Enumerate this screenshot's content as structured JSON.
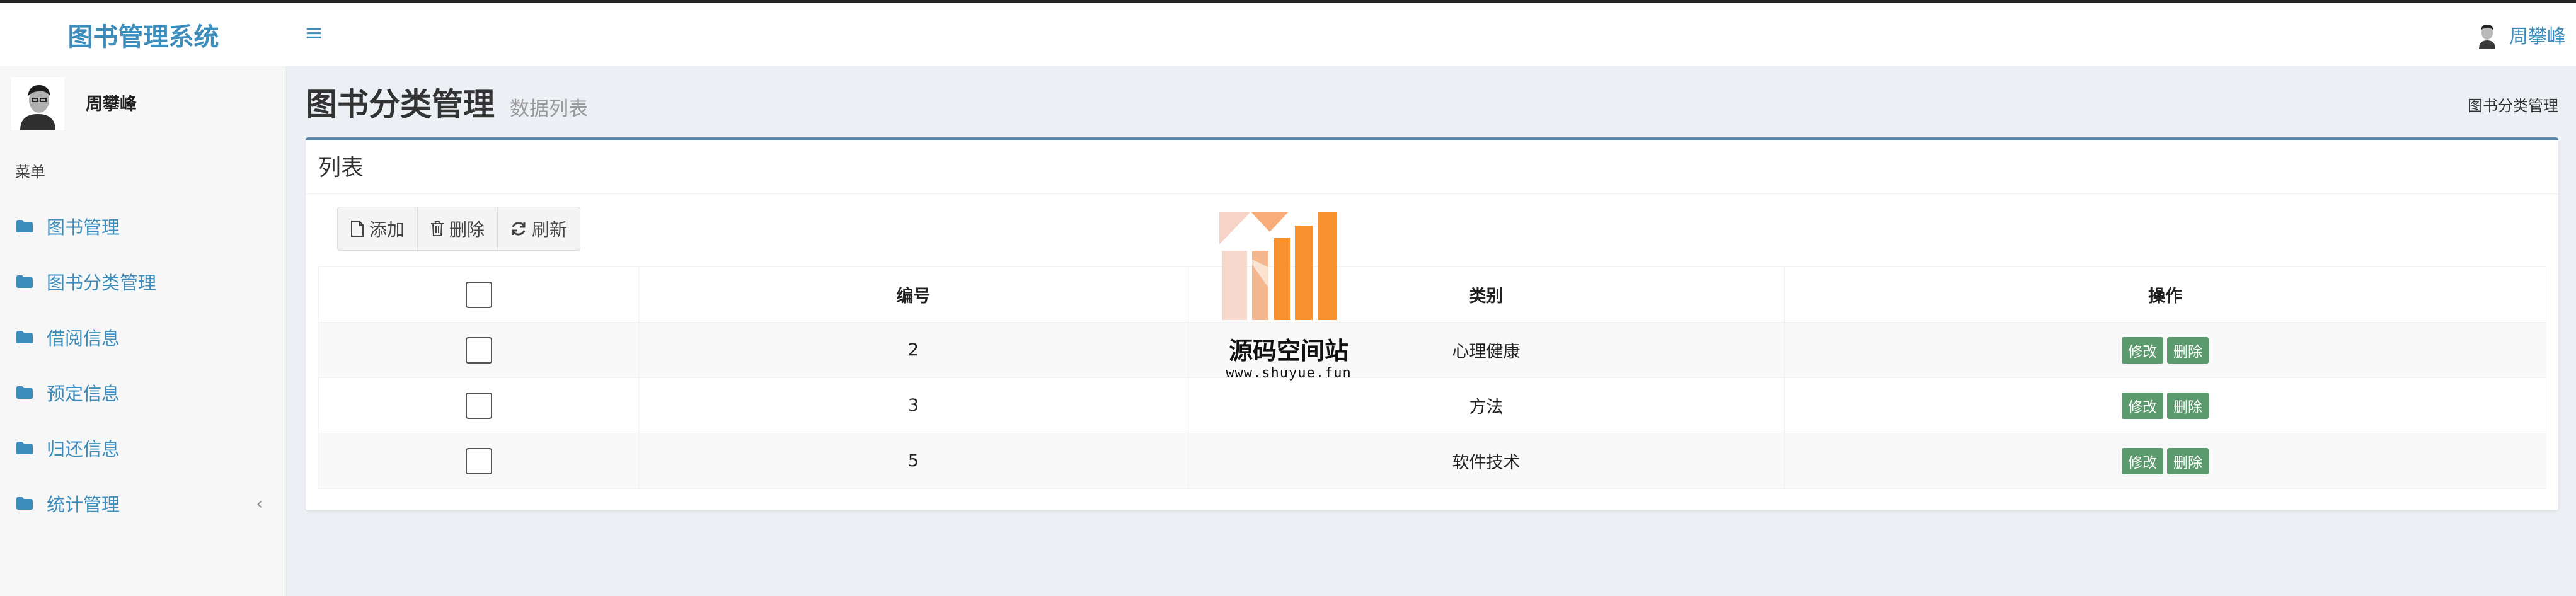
{
  "app": {
    "title": "图书管理系统"
  },
  "header": {
    "toggle_icon": "hamburger-icon",
    "user_name": "周攀峰"
  },
  "sidebar": {
    "user_name": "周攀峰",
    "menu_header": "菜单",
    "items": [
      {
        "label": "图书管理",
        "icon": "folder-icon"
      },
      {
        "label": "图书分类管理",
        "icon": "folder-icon"
      },
      {
        "label": "借阅信息",
        "icon": "folder-icon"
      },
      {
        "label": "预定信息",
        "icon": "folder-icon"
      },
      {
        "label": "归还信息",
        "icon": "folder-icon"
      },
      {
        "label": "统计管理",
        "icon": "folder-icon",
        "has_submenu": true
      }
    ]
  },
  "page": {
    "title": "图书分类管理",
    "subtitle": "数据列表",
    "breadcrumb": "图书分类管理"
  },
  "box": {
    "title": "列表",
    "buttons": {
      "add": "添加",
      "delete": "删除",
      "refresh": "刷新"
    }
  },
  "table": {
    "headers": {
      "id": "编号",
      "category": "类别",
      "actions": "操作"
    },
    "rows": [
      {
        "id": "2",
        "category": "心理健康"
      },
      {
        "id": "3",
        "category": "方法"
      },
      {
        "id": "5",
        "category": "软件技术"
      }
    ],
    "row_actions": {
      "edit": "修改",
      "delete": "删除"
    }
  },
  "watermark": {
    "title": "源码空间站",
    "url": "www.shuyue.fun"
  },
  "colors": {
    "accent": "#3c8dbc",
    "action_button": "#5b9a6c",
    "box_top": "#5f88ad",
    "background": "#ecf0f5"
  }
}
